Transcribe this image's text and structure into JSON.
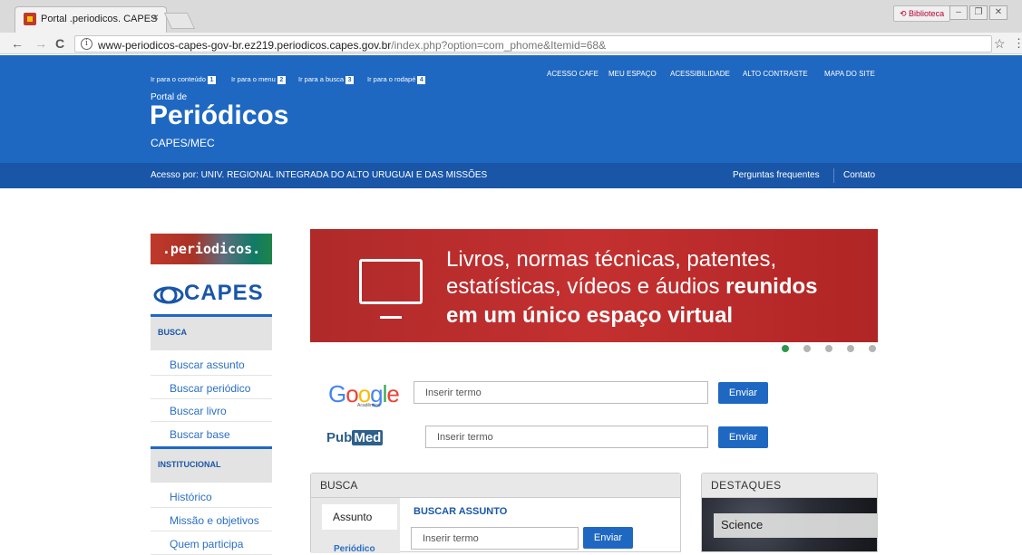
{
  "browser": {
    "tab_title": "Portal .periodicos. CAPES",
    "tab_close": "×",
    "extension_label": "Biblioteca",
    "url_domain": "www-periodicos-capes-gov-br.ez219.periodicos.capes.gov.br",
    "url_path": "/index.php?option=com_phome&Itemid=68&",
    "back_icon": "←",
    "forward_icon": "→",
    "reload_icon": "C",
    "info_icon": "i",
    "star_icon": "☆",
    "menu_icon": "⋮",
    "win_min": "–",
    "win_max": "❐",
    "win_close": "✕"
  },
  "header": {
    "skip_links": [
      {
        "label": "Ir para o conteúdo",
        "num": "1"
      },
      {
        "label": "Ir para o menu",
        "num": "2"
      },
      {
        "label": "Ir para a busca",
        "num": "3"
      },
      {
        "label": "Ir para o rodapé",
        "num": "4"
      }
    ],
    "top_links": [
      "ACESSO CAFE",
      "MEU ESPAÇO",
      "ACESSIBILIDADE",
      "ALTO CONTRASTE",
      "MAPA DO SITE"
    ],
    "brand_small": "Portal de",
    "brand_big": "Periódicos",
    "brand_sub": "CAPES/MEC",
    "access_text": "Acesso por: UNIV. REGIONAL INTEGRADA DO ALTO URUGUAI E DAS MISSÕES",
    "faq": "Perguntas frequentes",
    "contact": "Contato"
  },
  "sidebar": {
    "logo_periodicos": ".periodicos.",
    "logo_capes": "CAPES",
    "busca_head": "BUSCA",
    "busca_items": [
      "Buscar assunto",
      "Buscar periódico",
      "Buscar livro",
      "Buscar base"
    ],
    "inst_head": "INSTITUCIONAL",
    "inst_items": [
      "Histórico",
      "Missão e objetivos",
      "Quem participa"
    ]
  },
  "banner": {
    "line1": "Livros, normas técnicas, patentes,",
    "line2_pre": "estatísticas, vídeos e áudios",
    "line2_bold": "reunidos",
    "line3": "em um único espaço virtual",
    "active_slide": 1,
    "slide_count": 5
  },
  "search": {
    "google_logo": "Google",
    "google_sub": "Acadêmico",
    "google_placeholder": "Inserir termo",
    "google_button": "Enviar",
    "pubmed_pre": "Pub",
    "pubmed_med": "Med",
    "pubmed_placeholder": "Inserir termo",
    "pubmed_button": "Enviar"
  },
  "busca_panel": {
    "title": "BUSCA",
    "tab_assunto": "Assunto",
    "tab_periodico": "Periódico",
    "subtitle": "BUSCAR ASSUNTO",
    "placeholder": "Inserir termo",
    "button": "Enviar"
  },
  "destaques": {
    "title": "DESTAQUES",
    "item_label": "Science"
  },
  "colors": {
    "header_blue": "#1f68c2",
    "access_bar": "#1a56a8",
    "banner_red": "#c43030",
    "active_dot": "#2a9a4a"
  }
}
